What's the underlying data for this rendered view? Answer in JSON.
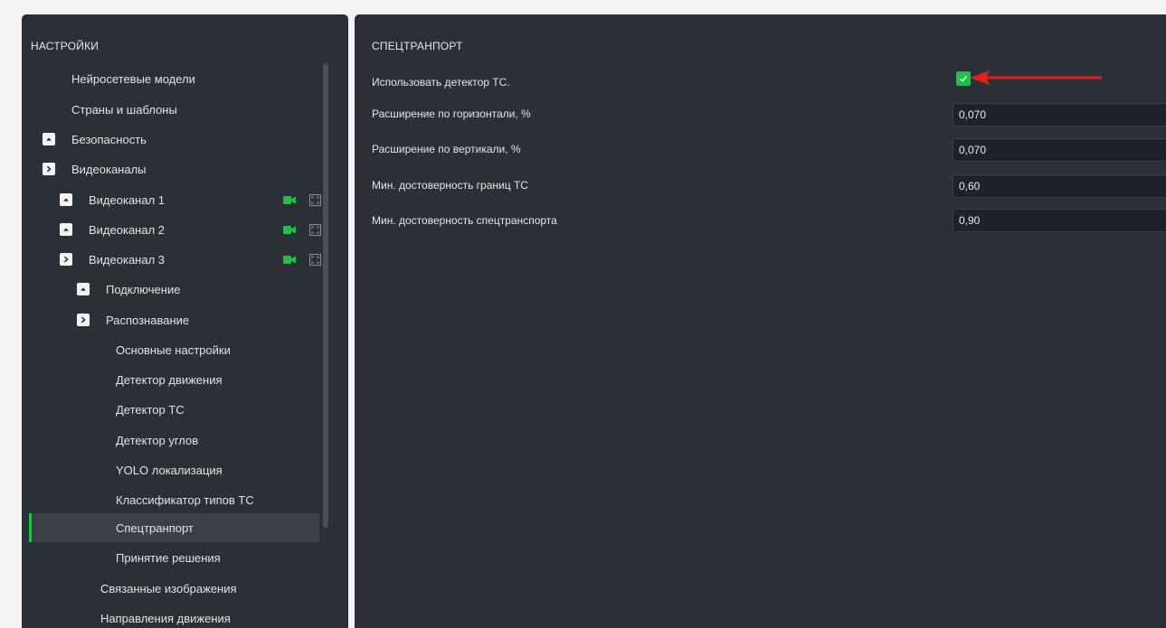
{
  "settings_panel": {
    "title": "НАСТРОЙКИ",
    "items": [
      {
        "label": "Нейросетевые модели"
      },
      {
        "label": "Страны и шаблоны"
      },
      {
        "label": "Безопасность",
        "toggle": "collapse"
      },
      {
        "label": "Видеоканалы",
        "toggle": "expand"
      },
      {
        "label": "Видеоканал 1",
        "toggle": "collapse",
        "icons": [
          "video-camera-icon",
          "selection-frame-icon"
        ]
      },
      {
        "label": "Видеоканал 2",
        "toggle": "collapse",
        "icons": [
          "video-camera-icon",
          "selection-frame-icon"
        ]
      },
      {
        "label": "Видеоканал 3",
        "toggle": "expand",
        "icons": [
          "video-camera-icon",
          "selection-frame-icon"
        ]
      },
      {
        "label": "Подключение",
        "toggle": "collapse"
      },
      {
        "label": "Распознавание",
        "toggle": "expand"
      },
      {
        "label": "Основные настройки"
      },
      {
        "label": "Детектор движения"
      },
      {
        "label": "Детектор ТС"
      },
      {
        "label": "Детектор углов"
      },
      {
        "label": "YOLO локализация"
      },
      {
        "label": "Классификатор типов ТС"
      },
      {
        "label": "Спецтранпорт",
        "selected": true
      },
      {
        "label": "Принятие решения"
      },
      {
        "label": "Связанные изображения"
      },
      {
        "label": "Направления движения"
      }
    ]
  },
  "detail_panel": {
    "title": "СПЕЦТРАНПОРТ",
    "fields": [
      {
        "label": "Использовать детектор ТС.",
        "type": "checkbox",
        "checked": true
      },
      {
        "label": "Расширение по горизонтали, %",
        "type": "text",
        "value": "0,070"
      },
      {
        "label": "Расширение по вертикали, %",
        "type": "text",
        "value": "0,070"
      },
      {
        "label": "Мин. достоверность границ ТС",
        "type": "text",
        "value": "0,60"
      },
      {
        "label": "Мин. достоверность спецтранспорта",
        "type": "text",
        "value": "0,90"
      }
    ]
  },
  "colors": {
    "panel_bg": "#2b2f36",
    "accent_green": "#1fbf4c",
    "annotation_red": "#e02020",
    "input_bg": "#1f2228"
  }
}
